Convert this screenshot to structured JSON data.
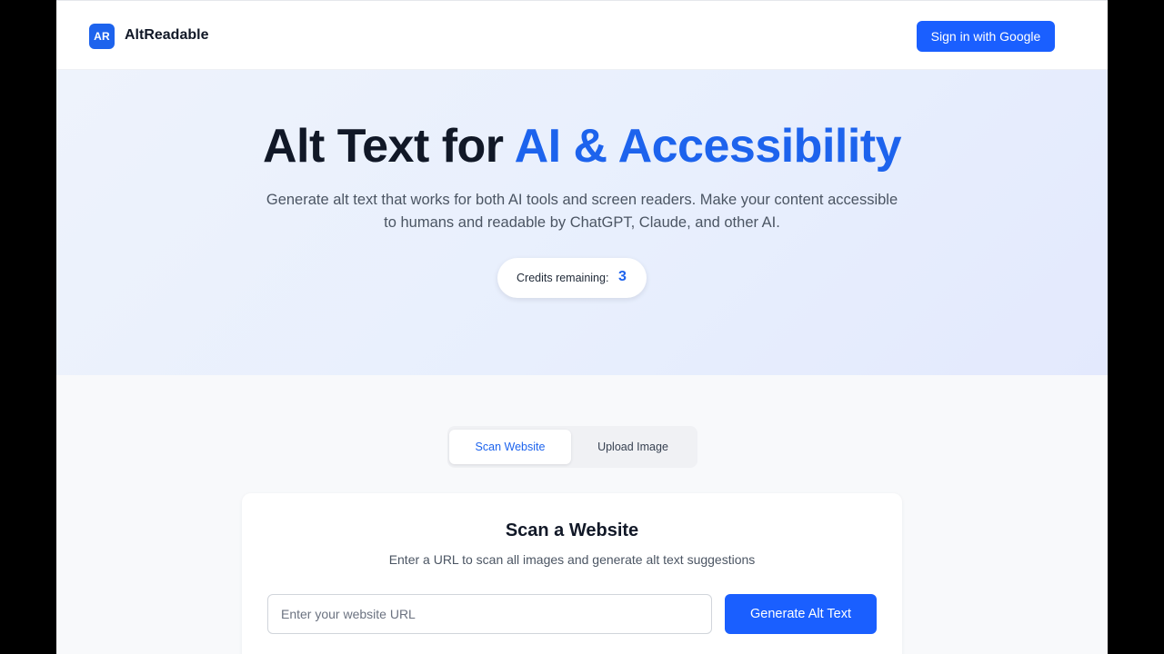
{
  "header": {
    "logo_text": "AR",
    "brand": "AltReadable",
    "signin_label": "Sign in with Google"
  },
  "hero": {
    "title_main": "Alt Text for ",
    "title_accent": "AI & Accessibility",
    "subtitle": "Generate alt text that works for both AI tools and screen readers. Make your content accessible to humans and readable by ChatGPT, Claude, and other AI.",
    "credits_label": "Credits remaining:",
    "credits_value": "3"
  },
  "tabs": [
    {
      "label": "Scan Website",
      "active": true
    },
    {
      "label": "Upload Image",
      "active": false
    }
  ],
  "scan_card": {
    "title": "Scan a Website",
    "subtitle": "Enter a URL to scan all images and generate alt text suggestions",
    "url_value": "",
    "url_placeholder": "Enter your website URL",
    "generate_label": "Generate Alt Text"
  },
  "colors": {
    "accent": "#1d63ed",
    "button": "#1a5fff",
    "hero_bg": "#e8effd",
    "text_dark": "#111827",
    "text_muted": "#4b5563"
  }
}
